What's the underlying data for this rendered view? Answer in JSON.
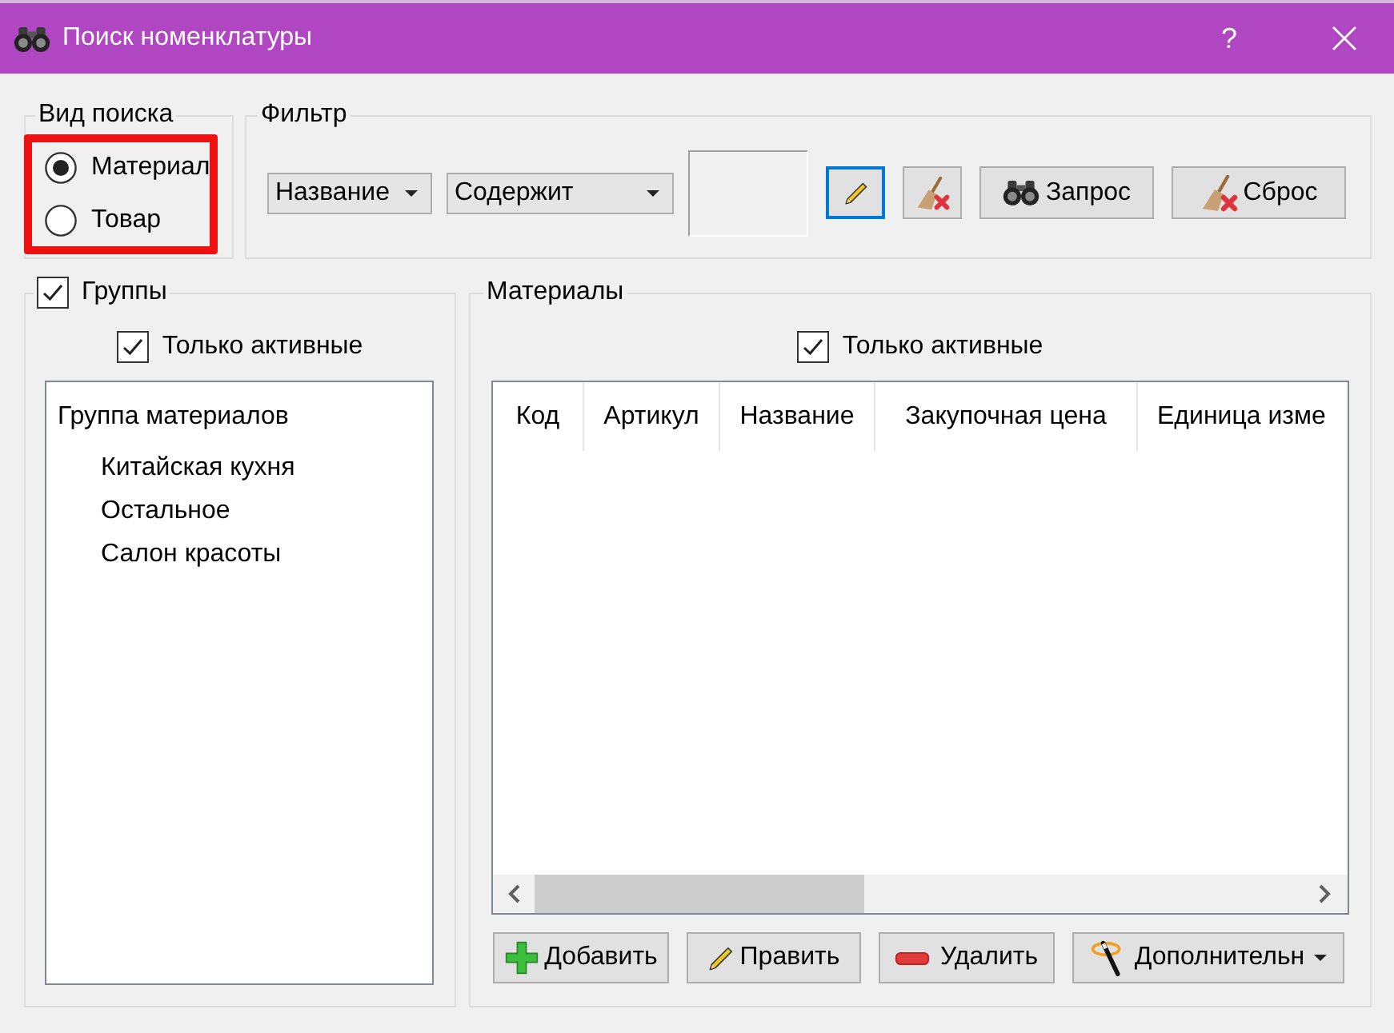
{
  "window": {
    "title": "Поиск номенклатуры",
    "help": "?"
  },
  "search_type": {
    "title": "Вид поиска",
    "highlighted": true,
    "options": [
      {
        "label": "Материал",
        "selected": true
      },
      {
        "label": "Товар",
        "selected": false
      }
    ]
  },
  "filter": {
    "title": "Фильтр",
    "field": {
      "value": "Название"
    },
    "condition": {
      "value": "Содержит"
    },
    "tool_buttons": [
      {
        "kind": "edit",
        "focused": true
      },
      {
        "kind": "clear",
        "focused": false
      }
    ],
    "buttons": [
      {
        "kind": "query",
        "label": "Запрос"
      },
      {
        "kind": "reset",
        "label": "Сброс"
      }
    ]
  },
  "groups": {
    "title": "Группы",
    "checked": true,
    "active_only": {
      "label": "Только активные",
      "checked": true
    },
    "tree": [
      {
        "label": "Группа материалов",
        "children": [
          {
            "label": "Китайская кухня"
          },
          {
            "label": "Остальное"
          },
          {
            "label": "Салон красоты"
          }
        ]
      }
    ]
  },
  "materials": {
    "title": "Материалы",
    "active_only": {
      "label": "Только активные",
      "checked": true
    },
    "table": {
      "columns": [
        "Код",
        "Артикул",
        "Название",
        "Закупочная цена",
        "Единица изме"
      ]
    },
    "buttons": [
      {
        "kind": "add",
        "label": "Добавить"
      },
      {
        "kind": "edit",
        "label": "Править"
      },
      {
        "kind": "delete",
        "label": "Удалить"
      },
      {
        "kind": "more",
        "label": "Дополнительн"
      }
    ]
  }
}
